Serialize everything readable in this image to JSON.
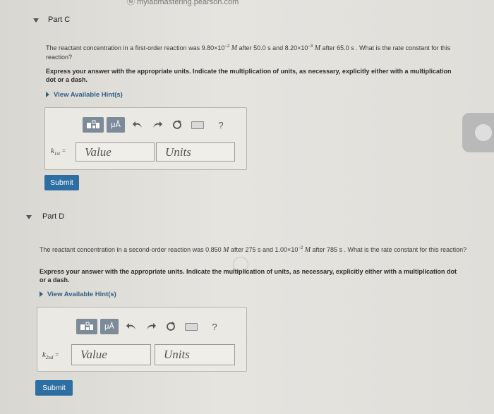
{
  "browser": {
    "url_fragment": "ⓦ mylabmastering.pearson.com"
  },
  "partC": {
    "title": "Part C",
    "question_pre": "The reactant concentration in a first-order reaction was 9.80×10",
    "exp1": "−2",
    "unit1": "M",
    "mid1": " after 50.0 s and 8.20×10",
    "exp2": "−3",
    "unit2": "M",
    "question_post": " after 65.0 s . What is the rate constant for this reaction?",
    "instruction": "Express your answer with the appropriate units. Indicate the multiplication of units, as necessary, explicitly either with a multiplication dot or a dash.",
    "hint": "View Available Hint(s)",
    "k_label": "k",
    "k_sub": "1st",
    "equals": "=",
    "value_placeholder": "Value",
    "units_placeholder": "Units",
    "submit": "Submit"
  },
  "partD": {
    "title": "Part D",
    "question_pre": "The reactant concentration in a second-order reaction was 0.850 ",
    "unit1": "M",
    "mid1": " after 275 s and 1.00×10",
    "exp1": "−2",
    "unit2": "M",
    "question_post": " after 785 s . What is the rate constant for this reaction?",
    "instruction": "Express your answer with the appropriate units. Indicate the multiplication of units, as necessary, explicitly either with a multiplication dot or a dash.",
    "hint": "View Available Hint(s)",
    "k_label": "k",
    "k_sub": "2nd",
    "equals": "=",
    "value_placeholder": "Value",
    "units_placeholder": "Units",
    "submit": "Submit"
  },
  "toolbar": {
    "mu_label": "μÅ",
    "help_label": "?",
    "undo_icon": "undo-icon",
    "redo_icon": "redo-icon",
    "reset_icon": "reset-icon",
    "keyboard_icon": "keyboard-icon"
  },
  "colors": {
    "accent": "#2e6fa3",
    "hint": "#2f5f86",
    "toolbar_btn": "#7d8a99"
  }
}
